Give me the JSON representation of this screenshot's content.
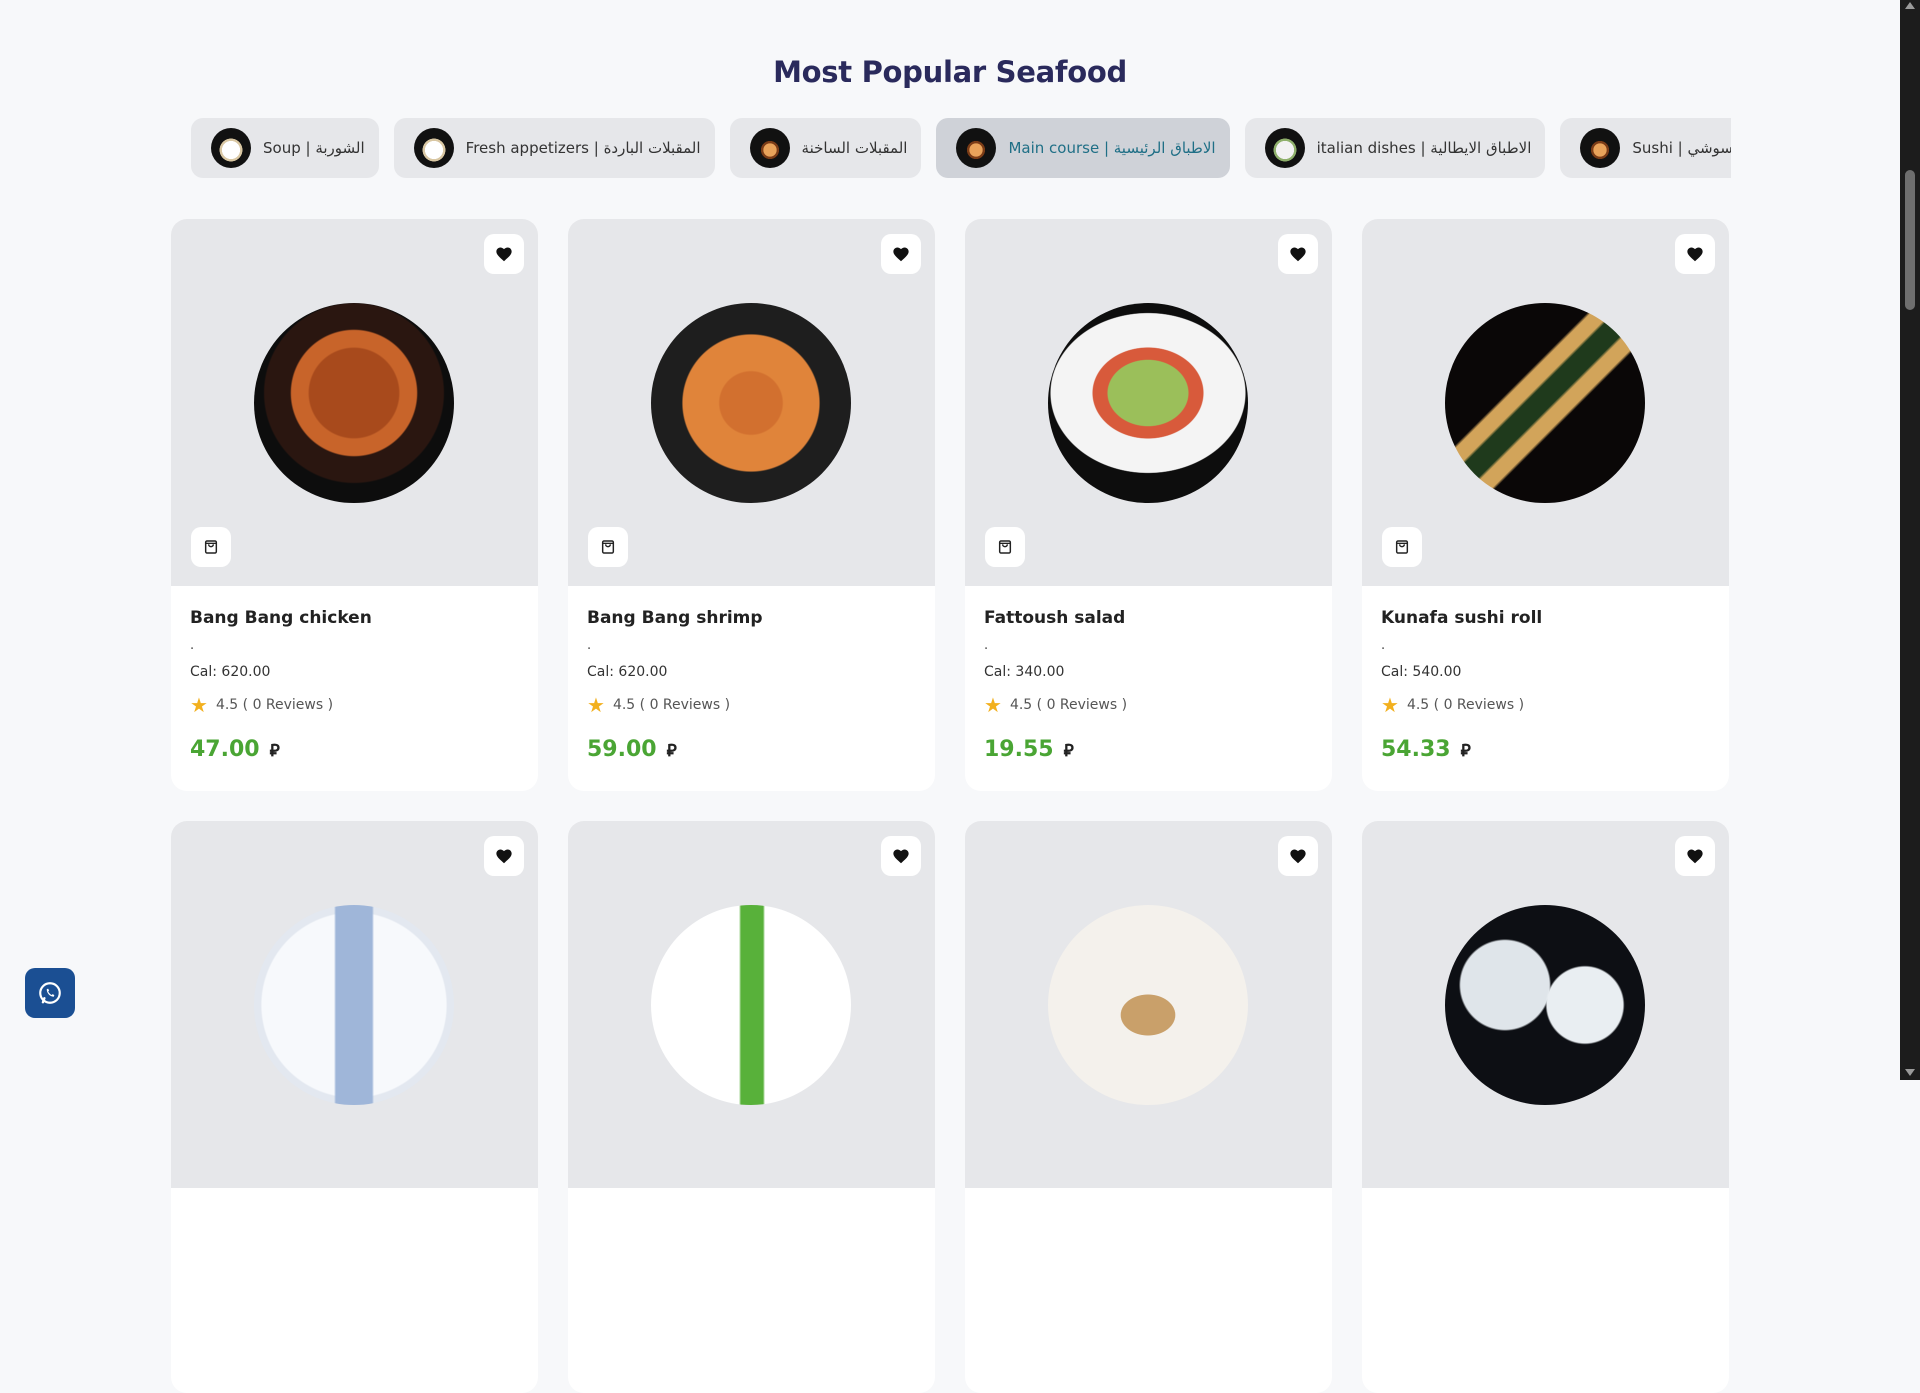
{
  "page_title": "Most Popular Seafood",
  "categories": [
    {
      "label": "Soup | الشوربة",
      "active": false
    },
    {
      "label": "Fresh appetizers | المقبلات الباردة",
      "active": false
    },
    {
      "label": "المقبلات الساخنة",
      "active": false
    },
    {
      "label": "Main course | الاطباق الرئيسية",
      "active": true
    },
    {
      "label": "italian dishes | الاطباق الايطالية",
      "active": false
    },
    {
      "label": "Sushi | السوشي",
      "active": false
    },
    {
      "label": "",
      "active": false
    }
  ],
  "products": [
    {
      "name": "Bang Bang chicken",
      "desc": ".",
      "cal": "Cal: 620.00",
      "rating": "4.5 ( 0 Reviews )",
      "price": "47.00",
      "currency": "⃁"
    },
    {
      "name": "Bang Bang shrimp",
      "desc": ".",
      "cal": "Cal: 620.00",
      "rating": "4.5 ( 0 Reviews )",
      "price": "59.00",
      "currency": "⃁"
    },
    {
      "name": "Fattoush salad",
      "desc": ".",
      "cal": "Cal: 340.00",
      "rating": "4.5 ( 0 Reviews )",
      "price": "19.55",
      "currency": "⃁"
    },
    {
      "name": "Kunafa sushi roll",
      "desc": ".",
      "cal": "Cal: 540.00",
      "rating": "4.5 ( 0 Reviews )",
      "price": "54.33",
      "currency": "⃁"
    }
  ],
  "icons": {
    "favorite": "heart-icon",
    "cart": "shopping-bag-icon",
    "rating": "star-icon",
    "whatsapp": "whatsapp-icon"
  },
  "colors": {
    "price": "#4aa534",
    "active_tab_text": "#1f6f86",
    "title": "#2a2a5c",
    "whatsapp_button": "#1b4f93"
  }
}
